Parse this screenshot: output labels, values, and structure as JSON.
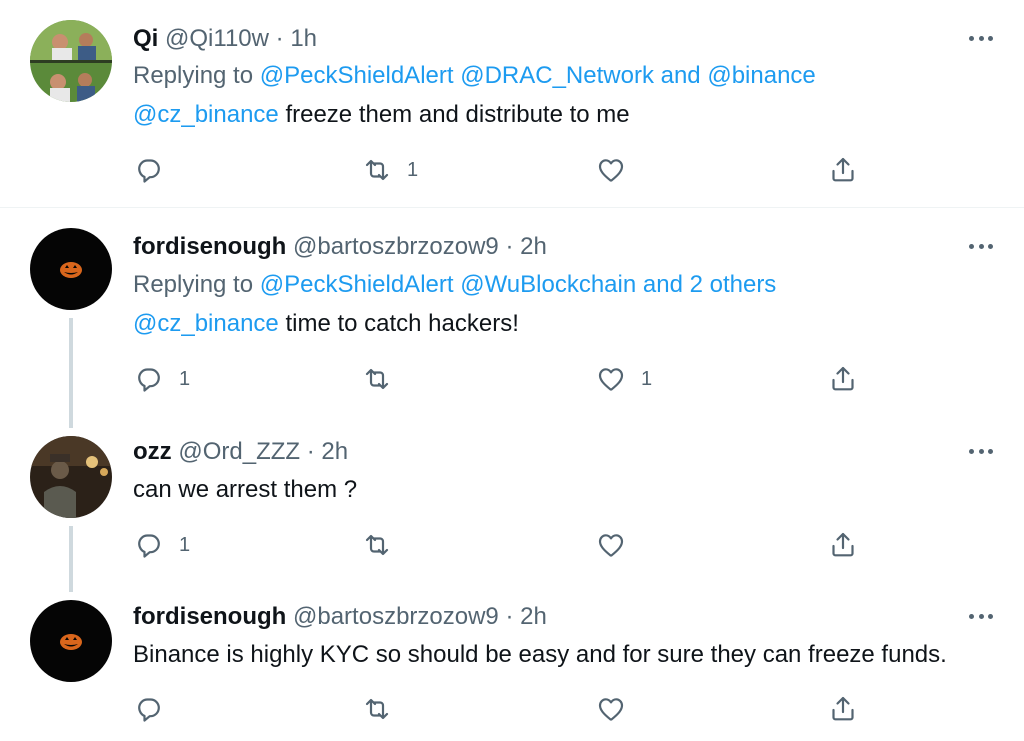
{
  "tweets": [
    {
      "name": "Qi",
      "handle": "@Qi110w",
      "dot": "·",
      "time": "1h",
      "replying_label": "Replying to",
      "replying_to": [
        "@PeckShieldAlert",
        "@DRAC_Network",
        "and",
        "@binance"
      ],
      "mention": "@cz_binance",
      "text": " freeze them and distribute to me",
      "reply_count": "",
      "retweet_count": "1",
      "like_count": ""
    },
    {
      "name": "fordisenough",
      "handle": "@bartoszbrzozow9",
      "dot": "·",
      "time": "2h",
      "replying_label": "Replying to",
      "replying_to": [
        "@PeckShieldAlert",
        "@WuBlockchain",
        "and 2 others"
      ],
      "mention": "@cz_binance",
      "text": " time to catch hackers!",
      "reply_count": "1",
      "retweet_count": "",
      "like_count": "1"
    },
    {
      "name": "ozz",
      "handle": "@Ord_ZZZ",
      "dot": "·",
      "time": "2h",
      "text": "can we arrest them ?",
      "reply_count": "1",
      "retweet_count": "",
      "like_count": ""
    },
    {
      "name": "fordisenough",
      "handle": "@bartoszbrzozow9",
      "dot": "·",
      "time": "2h",
      "text": "Binance is highly KYC so should be easy and for sure they can freeze funds.",
      "reply_count": "",
      "retweet_count": "",
      "like_count": ""
    }
  ],
  "icons": {
    "reply": "reply-icon",
    "retweet": "retweet-icon",
    "like": "heart-icon",
    "share": "share-icon",
    "more": "more-icon"
  },
  "colors": {
    "link": "#1d9bf0",
    "muted": "#536471",
    "text": "#0f1419",
    "thread_line": "#cfd9de"
  }
}
